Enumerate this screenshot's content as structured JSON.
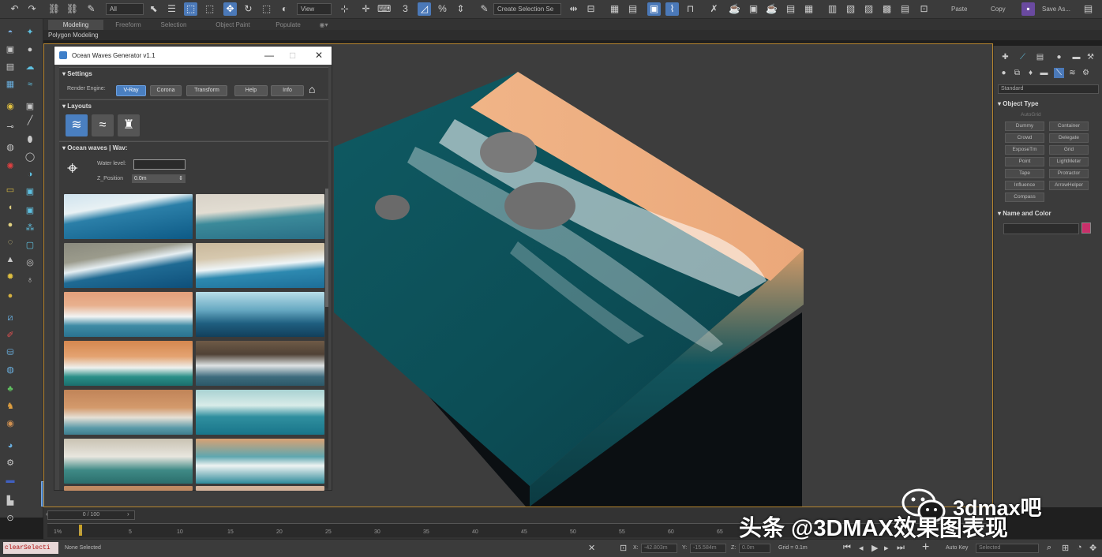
{
  "toolbar": {
    "filter_dropdown": "All",
    "view_dropdown": "View",
    "selection_set": "Create Selection Se",
    "paste_label": "Paste",
    "copy_label": "Copy",
    "save_label": "Save As..."
  },
  "ribbon": {
    "tabs": [
      "Modeling",
      "Freeform",
      "Selection",
      "Object Paint",
      "Populate"
    ],
    "active_tab": "Modeling",
    "subtab": "Polygon Modeling"
  },
  "dialog": {
    "title": "Ocean Waves Generator v1.1",
    "settings_title": "Settings",
    "render_engine_label": "Render Engine:",
    "buttons": [
      "V-Ray",
      "Corona",
      "Transform",
      "Help",
      "Info"
    ],
    "layouts_title": "Layouts",
    "waves_title": "Ocean waves | Wav:",
    "water_level_label": "Water level:",
    "zpos_label": "Z_Position",
    "zpos_value": "0.0m"
  },
  "command_panel": {
    "renderer_dropdown": "Standard",
    "object_type_title": "Object Type",
    "autogrid_label": "AutoGrid",
    "buttons": [
      "Dummy",
      "Container",
      "Crowd",
      "Delegate",
      "ExposeTm",
      "Grid",
      "Point",
      "LightMeter",
      "Tape",
      "Protractor",
      "Influence",
      "ArrowHelper",
      "Compass"
    ],
    "name_color_title": "Name and Color",
    "object_color": "#c8306a"
  },
  "timeline": {
    "slider_label": "0 / 100",
    "ticks": [
      "0",
      "5",
      "10",
      "15",
      "20",
      "25",
      "30",
      "35",
      "40",
      "45",
      "50",
      "55",
      "60",
      "65"
    ],
    "start_marker": "1%"
  },
  "status": {
    "script": "clearSelecti",
    "selection": "None Selected",
    "x_label": "X:",
    "x_value": "-42.803m",
    "y_label": "Y:",
    "y_value": "-15.584m",
    "z_label": "Z:",
    "z_value": "0.0m",
    "grid": "Grid = 0.1m",
    "autokey": "Auto Key",
    "selected_dropdown": "Selected"
  },
  "watermark": {
    "line1": "3dmax吧",
    "line2": "头条 @3DMAX效果图表现"
  }
}
